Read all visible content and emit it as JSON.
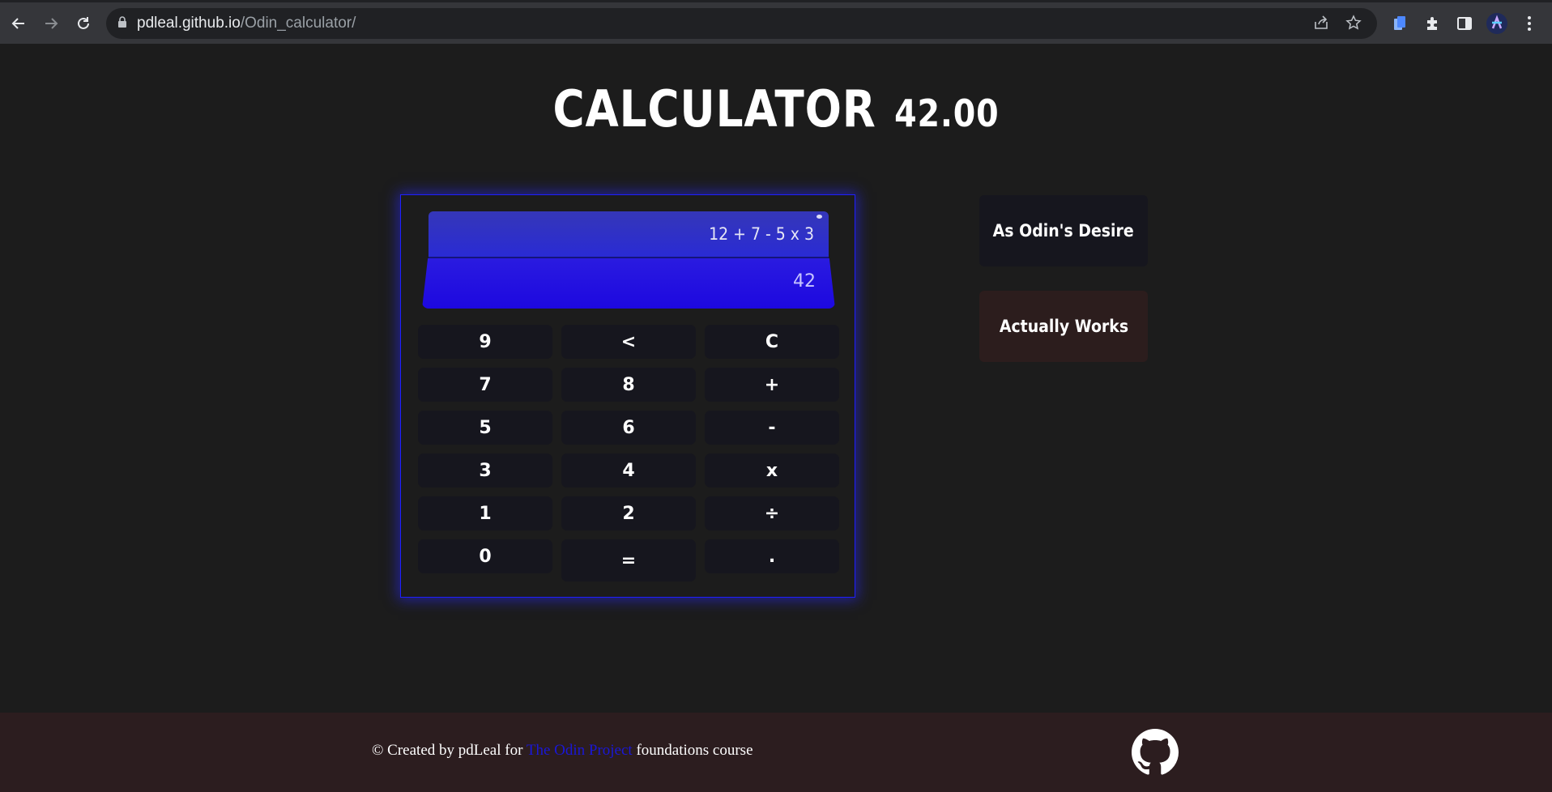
{
  "browser": {
    "url_host": "pdleal.github.io",
    "url_path": "/Odin_calculator/"
  },
  "page": {
    "title": "CALCULATOR",
    "title_number": "42.00"
  },
  "calculator": {
    "expression": "12 + 7 - 5 x 3",
    "result": "42",
    "keys": [
      "9",
      "<",
      "C",
      "7",
      "8",
      "+",
      "5",
      "6",
      "-",
      "3",
      "4",
      "x",
      "1",
      "2",
      "÷",
      "0",
      "=",
      "."
    ]
  },
  "side_buttons": {
    "odin": "As Odin's Desire",
    "works": "Actually Works"
  },
  "footer": {
    "prefix": "© Created by pdLeal for",
    "link": "The Odin Project",
    "suffix": "foundations course"
  },
  "colors": {
    "accent": "#1f1fff",
    "link": "#1a17d6",
    "background": "#1c1c1c",
    "footer": "#2c1d1f"
  }
}
